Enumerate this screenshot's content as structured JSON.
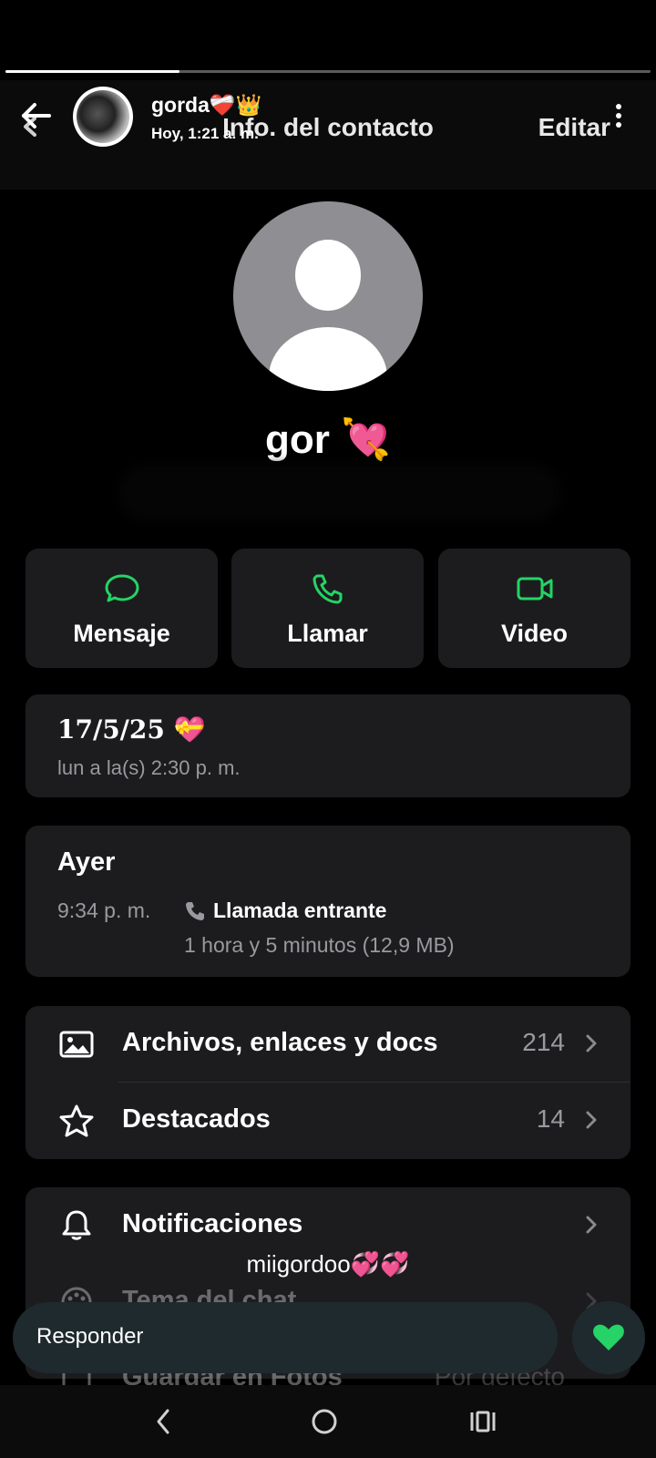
{
  "story": {
    "progress": 0.27,
    "name": "gorda❤️‍🩹👑",
    "time": "Hoy, 1:21 a. m."
  },
  "screen": {
    "title": "Info. del contacto",
    "edit_label": "Editar",
    "contact_name": "gor 💘"
  },
  "actions": [
    {
      "label": "Mensaje",
      "icon": "message-icon"
    },
    {
      "label": "Llamar",
      "icon": "phone-icon"
    },
    {
      "label": "Video",
      "icon": "video-icon"
    }
  ],
  "date_card": {
    "title": "17/5/25 💝",
    "subtitle": "lun a la(s) 2:30 p. m."
  },
  "call_card": {
    "day": "Ayer",
    "time": "9:34 p. m.",
    "type": "Llamada entrante",
    "duration": "1 hora y 5 minutos (12,9 MB)"
  },
  "media_rows": [
    {
      "label": "Archivos, enlaces y docs",
      "count": "214",
      "icon": "image-icon"
    },
    {
      "label": "Destacados",
      "count": "14",
      "icon": "star-icon"
    }
  ],
  "settings_rows": [
    {
      "label": "Notificaciones",
      "icon": "bell-icon"
    },
    {
      "label": "Tema del chat",
      "icon": "palette-icon"
    },
    {
      "label": "Guardar en Fotos",
      "value": "Por defecto",
      "icon": "save-icon"
    }
  ],
  "caption": "miigordoo💞💞",
  "reply": {
    "placeholder": "Responder"
  },
  "colors": {
    "accent": "#25d366",
    "card": "#1c1c1e",
    "reply": "#1f2a2f"
  }
}
